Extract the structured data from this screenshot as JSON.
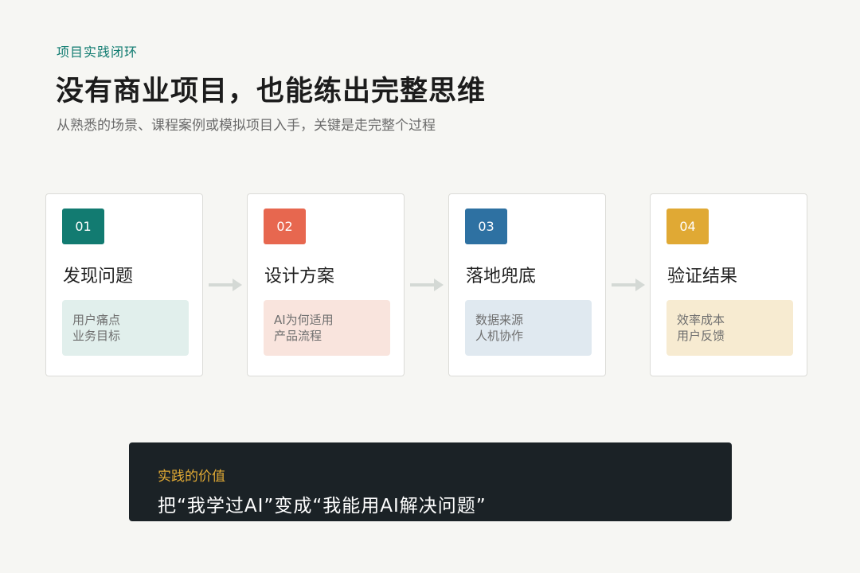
{
  "header": {
    "eyebrow": "项目实践闭环",
    "title": "没有商业项目，也能练出完整思维",
    "subtitle": "从熟悉的场景、课程案例或模拟项目入手，关键是走完整个过程"
  },
  "steps": [
    {
      "number": "01",
      "title": "发现问题",
      "tags": [
        "用户痛点",
        "业务目标"
      ],
      "color": "#127b71",
      "tint": "#e1efec"
    },
    {
      "number": "02",
      "title": "设计方案",
      "tags": [
        "AI为何适用",
        "产品流程"
      ],
      "color": "#e7674f",
      "tint": "#f9e4dd"
    },
    {
      "number": "03",
      "title": "落地兜底",
      "tags": [
        "数据来源",
        "人机协作"
      ],
      "color": "#2e71a2",
      "tint": "#e0e9f0"
    },
    {
      "number": "04",
      "title": "验证结果",
      "tags": [
        "效率成本",
        "用户反馈"
      ],
      "color": "#e0a934",
      "tint": "#f7ebd1"
    }
  ],
  "arrow_icon": "arrow-right-icon",
  "callout": {
    "label": "实践的价值",
    "text": "把“我学过AI”变成“我能用AI解决问题”"
  }
}
